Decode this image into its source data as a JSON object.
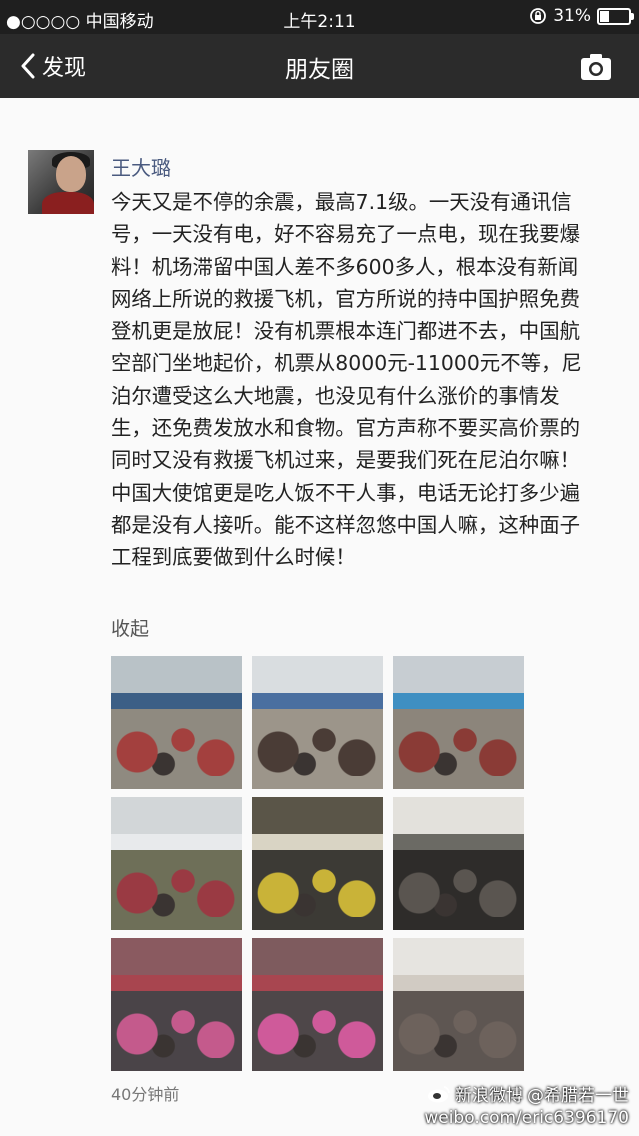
{
  "status_bar": {
    "carrier": "●○○○○ 中国移动",
    "time": "上午2:11",
    "battery": "31%",
    "battery_level": 0.31
  },
  "nav": {
    "back_label": "发现",
    "title": "朋友圈"
  },
  "post": {
    "username": "王大璐",
    "text": "今天又是不停的余震，最高7.1级。一天没有通讯信号，一天没有电，好不容易充了一点电，现在我要爆料！机场滞留中国人差不多600多人，根本没有新闻网络上所说的救援飞机，官方所说的持中国护照免费登机更是放屁！没有机票根本连门都进不去，中国航空部门坐地起价，机票从8000元-11000元不等，尼泊尔遭受这么大地震，也没见有什么涨价的事情发生，还免费发放水和食物。官方声称不要买高价票的同时又没有救援飞机过来，是要我们死在尼泊尔嘛！中国大使馆更是吃人饭不干人事，电话无论打多少遍都是没有人接听。能不这样忽悠中国人嘛，这种面子工程到底要做到什么时候！",
    "collapse_label": "收起",
    "timestamp": "40分钟前"
  },
  "photos": [
    {
      "sky": "#b9c2c7",
      "tent": "#3c5f86",
      "ground": "#8f8a80",
      "crowd": "#a3403e"
    },
    {
      "sky": "#d9dde0",
      "tent": "#4a6fa0",
      "ground": "#9c958a",
      "crowd": "#4a3c36"
    },
    {
      "sky": "#c7cdd2",
      "tent": "#3f8fc2",
      "ground": "#8c857b",
      "crowd": "#8a3b36"
    },
    {
      "sky": "#d2d6d8",
      "tent": "#e8eaec",
      "ground": "#6e6f58",
      "crowd": "#9a3a43"
    },
    {
      "sky": "#5a5548",
      "tent": "#d9d4c4",
      "ground": "#3c3a35",
      "crowd": "#c9b338"
    },
    {
      "sky": "#e3e1dc",
      "tent": "#6b6a64",
      "ground": "#2e2c2a",
      "crowd": "#5a5550"
    },
    {
      "sky": "#8a5a60",
      "tent": "#a8454f",
      "ground": "#4a4448",
      "crowd": "#c45a8c"
    },
    {
      "sky": "#7e5b5e",
      "tent": "#a84650",
      "ground": "#4e4749",
      "crowd": "#cf5a9a"
    },
    {
      "sky": "#e6e4e0",
      "tent": "#d1cbc3",
      "ground": "#5e5652",
      "crowd": "#6d625c"
    }
  ],
  "watermark": {
    "brand": "新浪微博",
    "handle": "@希腊若一世",
    "url": "weibo.com/eric6396170"
  }
}
